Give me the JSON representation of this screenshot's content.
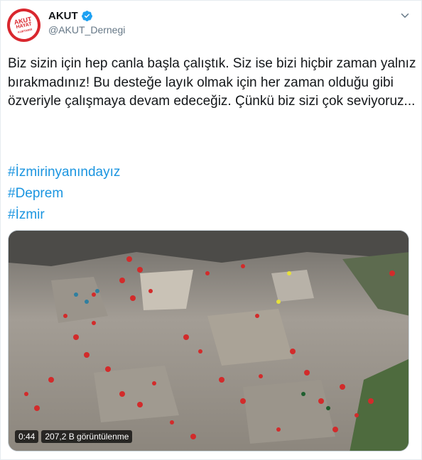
{
  "account": {
    "display_name": "AKUT",
    "handle": "@AKUT_Dernegi",
    "logo_lines": [
      "AKUT",
      "HAYAT",
      "KURTARIR"
    ]
  },
  "tweet": {
    "text": "Biz sizin için hep canla başla çalıştık. Siz ise bizi hiçbir zaman yalnız bırakmadınız! Bu desteğe layık olmak için her zaman olduğu gibi özveriyle çalışmaya devam edeceğiz. Çünkü biz sizi çok seviyoruz...",
    "hashtags": [
      "#İzmirinyanındayız",
      "#Deprem",
      "#İzmir"
    ]
  },
  "video": {
    "duration": "0:44",
    "views": "207,2 B görüntülenme"
  },
  "colors": {
    "link": "#1b95e0",
    "verified": "#1da1f2",
    "logo_red": "#d9272e"
  },
  "icons": [
    "verified-badge-icon",
    "chevron-down-icon"
  ]
}
